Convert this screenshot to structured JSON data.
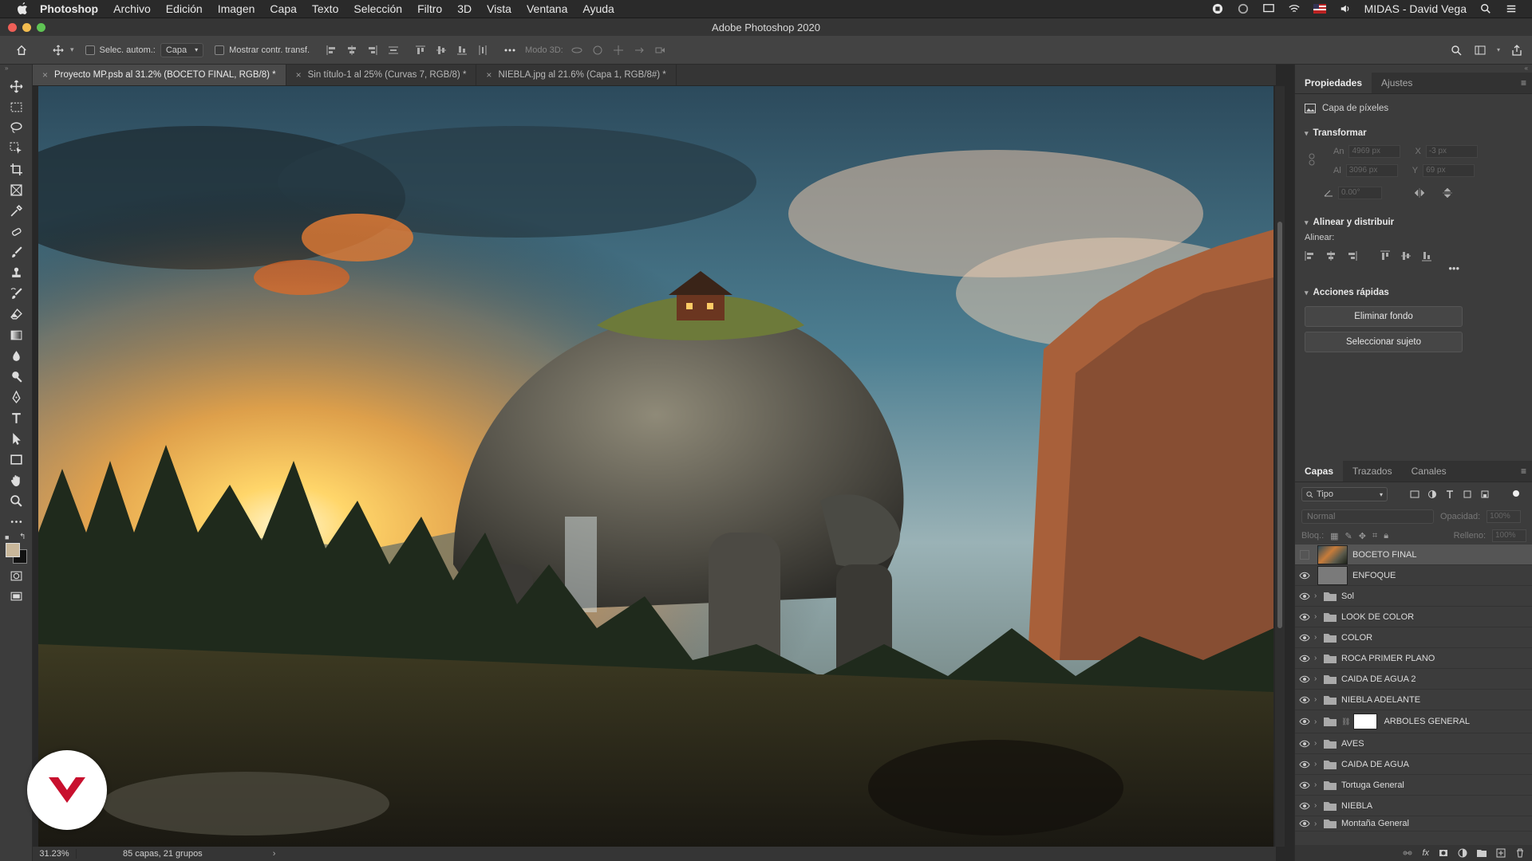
{
  "menubar": {
    "app": "Photoshop",
    "items": [
      "Archivo",
      "Edición",
      "Imagen",
      "Capa",
      "Texto",
      "Selección",
      "Filtro",
      "3D",
      "Vista",
      "Ventana",
      "Ayuda"
    ],
    "user": "MIDAS - David Vega"
  },
  "window": {
    "title": "Adobe Photoshop 2020"
  },
  "options": {
    "auto_select_label": "Selec. autom.:",
    "auto_select_target": "Capa",
    "show_transform_label": "Mostrar contr. transf.",
    "mode3d_label": "Modo 3D:"
  },
  "tabs": [
    {
      "label": "Proyecto MP.psb al 31.2% (BOCETO FINAL, RGB/8) *",
      "active": true
    },
    {
      "label": "Sin título-1 al 25% (Curvas 7, RGB/8) *",
      "active": false
    },
    {
      "label": "NIEBLA.jpg al 21.6% (Capa 1, RGB/8#) *",
      "active": false
    }
  ],
  "status": {
    "zoom": "31.23%",
    "info": "85 capas, 21 grupos"
  },
  "properties": {
    "tabs": [
      "Propiedades",
      "Ajustes"
    ],
    "layer_type": "Capa de píxeles",
    "transform_title": "Transformar",
    "an_label": "An",
    "an_value": "4969 px",
    "x_label": "X",
    "x_value": "-3 px",
    "al_label": "Al",
    "al_value": "3096 px",
    "y_label": "Y",
    "y_value": "69 px",
    "angle_value": "0.00°",
    "align_title": "Alinear y distribuir",
    "align_label": "Alinear:",
    "quick_actions_title": "Acciones rápidas",
    "remove_bg": "Eliminar fondo",
    "select_subject": "Seleccionar sujeto"
  },
  "layers_panel": {
    "tabs": [
      "Capas",
      "Trazados",
      "Canales"
    ],
    "filter": "Tipo",
    "blend_mode": "Normal",
    "opacity_label": "Opacidad:",
    "opacity_value": "100%",
    "lock_label": "Bloq.:",
    "fill_label": "Relleno:",
    "fill_value": "100%",
    "layers": [
      {
        "name": "BOCETO FINAL",
        "kind": "image",
        "visible": false,
        "selected": true
      },
      {
        "name": "ENFOQUE",
        "kind": "gray",
        "visible": true
      },
      {
        "name": "Sol",
        "kind": "group",
        "visible": true
      },
      {
        "name": "LOOK DE COLOR",
        "kind": "group",
        "visible": true
      },
      {
        "name": "COLOR",
        "kind": "group",
        "visible": true
      },
      {
        "name": "ROCA PRIMER PLANO",
        "kind": "group",
        "visible": true
      },
      {
        "name": "CAIDA DE AGUA 2",
        "kind": "group",
        "visible": true
      },
      {
        "name": "NIEBLA ADELANTE",
        "kind": "group",
        "visible": true
      },
      {
        "name": "ARBOLES GENERAL",
        "kind": "group-mask",
        "visible": true
      },
      {
        "name": "AVES",
        "kind": "group",
        "visible": true
      },
      {
        "name": "CAIDA DE AGUA",
        "kind": "group",
        "visible": true
      },
      {
        "name": "Tortuga General",
        "kind": "group",
        "visible": true
      },
      {
        "name": "NIEBLA",
        "kind": "group",
        "visible": true
      },
      {
        "name": "Montaña General",
        "kind": "group",
        "visible": true
      }
    ]
  },
  "colors": {
    "accent_logo": "#c8102e",
    "fg_swatch": "#c9b79a",
    "bg_swatch": "#111111"
  }
}
